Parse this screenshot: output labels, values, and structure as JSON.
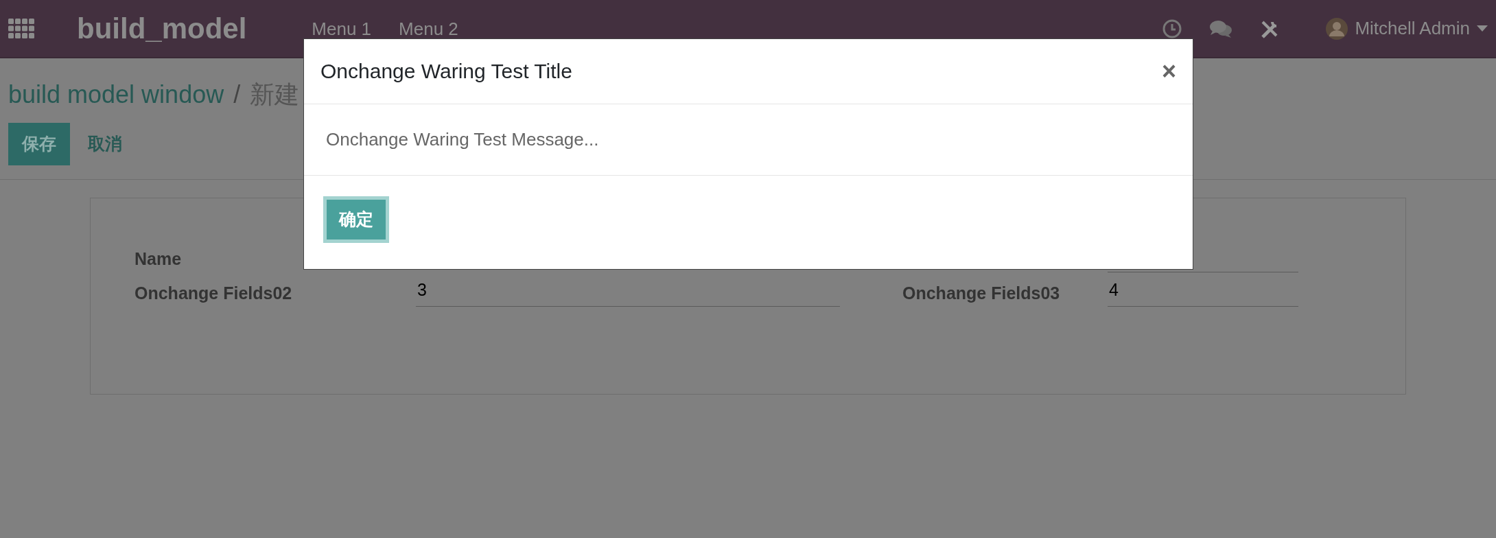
{
  "navbar": {
    "app_title": "build_model",
    "menus": [
      "Menu 1",
      "Menu 2"
    ],
    "user": "Mitchell Admin"
  },
  "breadcrumb": {
    "parent": "build model window",
    "separator": "/",
    "current": "新建"
  },
  "actions": {
    "save": "保存",
    "discard": "取消"
  },
  "form": {
    "rows": [
      {
        "label": "Name",
        "value": ""
      },
      {
        "label": "Onchange Fields02",
        "value": "3",
        "right_label": "Onchange Fields03",
        "right_value": "4"
      }
    ]
  },
  "dialog": {
    "title": "Onchange Waring Test Title",
    "close": "×",
    "message": "Onchange Waring Test Message...",
    "ok": "确定"
  }
}
